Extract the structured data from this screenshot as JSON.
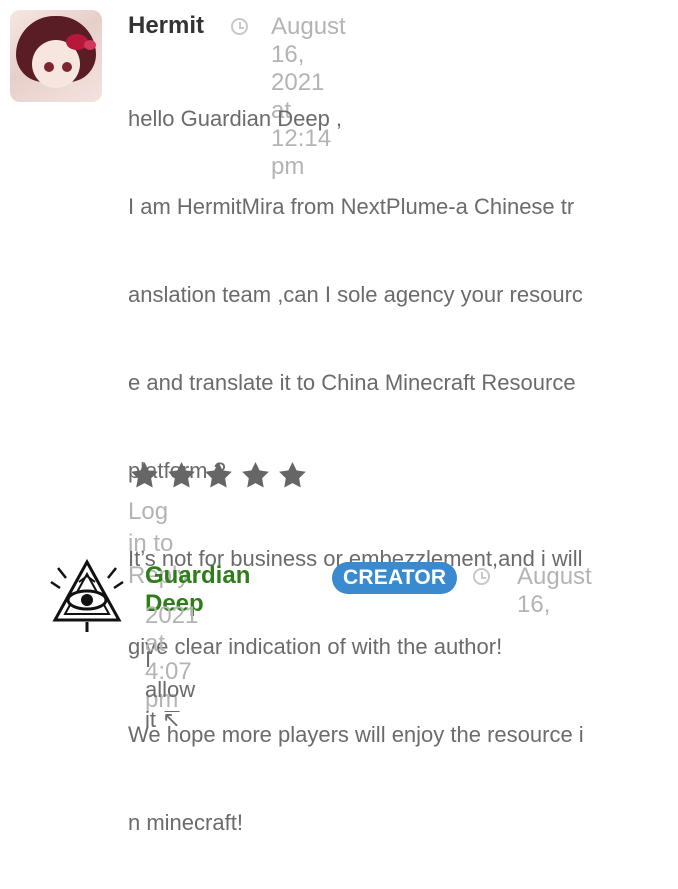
{
  "comment": {
    "author": "Hermit",
    "date": "August 16, 2021 at 12:14 pm",
    "body_lines": [
      "hello Guardian Deep  ,",
      "I am HermitMira from NextPlume-a Chinese tr",
      "anslation team ,can I sole agency your resourc",
      "e and translate it to China Minecraft Resource",
      "platform ?",
      "It’s not for business or embezzlement,and i will",
      "give clear indication of with the author!",
      "We hope more players will enjoy the resource i",
      "n minecraft!"
    ],
    "rating": 5,
    "reply_link": "Log in to Reply"
  },
  "reply": {
    "author": "Guardian Deep",
    "badge": "CREATOR",
    "date_line_1": "August 16,",
    "date_line_2": "2021 at 4:07 pm",
    "text": "I allow it ↸"
  },
  "colors": {
    "author_main": "#333333",
    "author_reply": "#2f7d1a",
    "badge_bg": "#3a8ad0",
    "meta": "#b4b4b4",
    "text": "#6b6b6b",
    "stars": "#666666"
  },
  "icons": {
    "comment_time": "clock-icon",
    "reply_time": "clock-icon",
    "rating": "star-icon",
    "reply_arrow": "up-left-arrow-icon"
  }
}
